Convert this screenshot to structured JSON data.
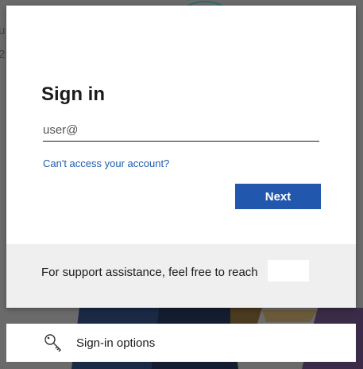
{
  "background": {
    "partial_text": [
      "u",
      "2"
    ]
  },
  "signin": {
    "title": "Sign in",
    "email_value": "user@",
    "cant_access_link": "Can't access your account?",
    "next_label": "Next"
  },
  "footer": {
    "support_text": "For support assistance, feel free to reach"
  },
  "options": {
    "label": "Sign-in options",
    "icon": "key-icon"
  },
  "colors": {
    "accent": "#2158ad",
    "link": "#1f5cad",
    "footer_bg": "#efefef"
  }
}
